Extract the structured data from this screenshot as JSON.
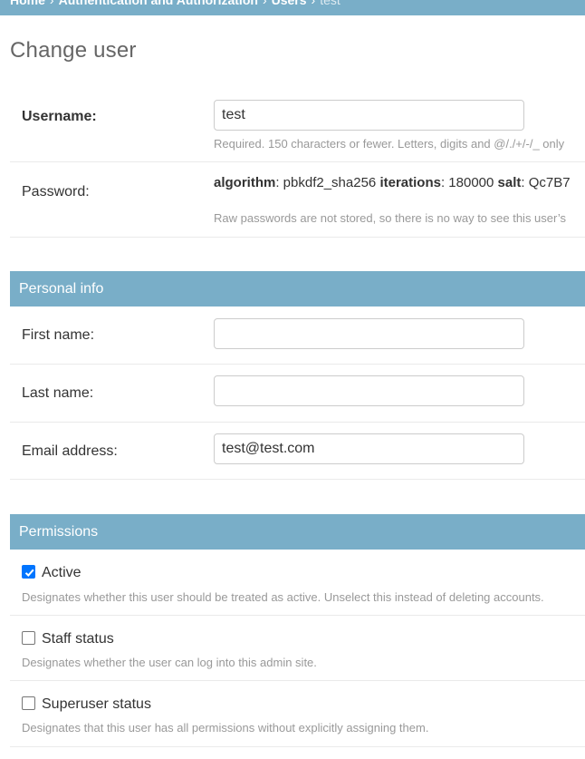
{
  "breadcrumbs": {
    "home": "Home",
    "app": "Authentication and Authorization",
    "model": "Users",
    "current": "test"
  },
  "page": {
    "title": "Change user"
  },
  "username": {
    "label": "Username:",
    "value": "test",
    "help": "Required. 150 characters or fewer. Letters, digits and @/./+/-/_ only"
  },
  "password": {
    "label": "Password:",
    "algorithm_key": "algorithm",
    "algorithm_value": ": pbkdf2_sha256 ",
    "iterations_key": "iterations",
    "iterations_value": ": 180000 ",
    "salt_key": "salt",
    "salt_value": ": Qc7B7",
    "help": "Raw passwords are not stored, so there is no way to see this user’s"
  },
  "personal_info": {
    "header": "Personal info",
    "first_name_label": "First name:",
    "first_name_value": "",
    "last_name_label": "Last name:",
    "last_name_value": "",
    "email_label": "Email address:",
    "email_value": "test@test.com"
  },
  "permissions": {
    "header": "Permissions",
    "active_label": "Active",
    "active_checked": true,
    "active_help": "Designates whether this user should be treated as active. Unselect this instead of deleting accounts.",
    "staff_label": "Staff status",
    "staff_checked": false,
    "staff_help": "Designates whether the user can log into this admin site.",
    "superuser_label": "Superuser status",
    "superuser_checked": false,
    "superuser_help": "Designates that this user has all permissions without explicitly assigning them."
  },
  "colors": {
    "header_bg": "#79aec8",
    "checkbox_checked": "#0075ff",
    "help_text": "#999999"
  }
}
